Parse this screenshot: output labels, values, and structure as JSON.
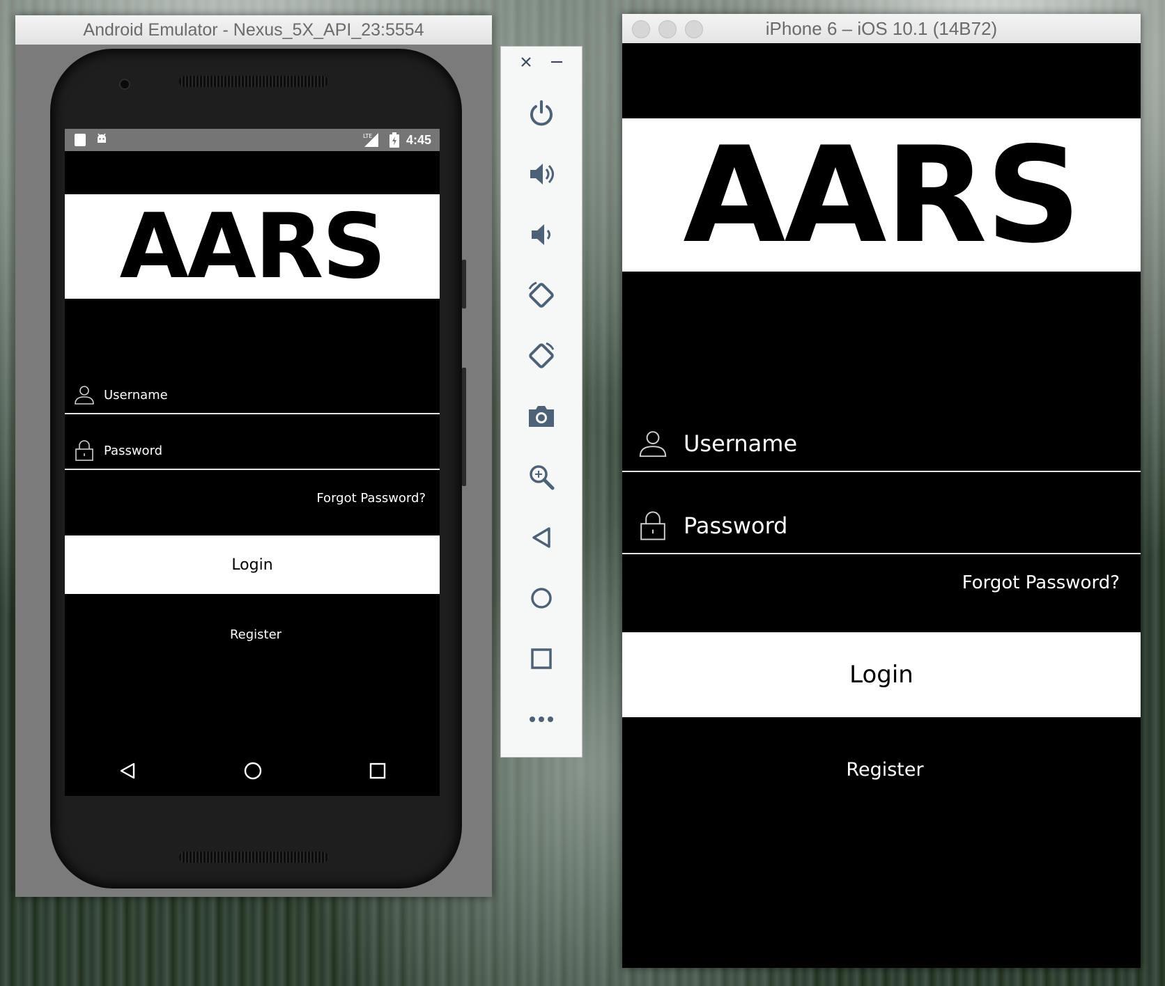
{
  "android": {
    "window_title": "Android Emulator - Nexus_5X_API_23:5554",
    "status_time": "4:45",
    "status_network": "LTE",
    "app": {
      "logo": "AARS",
      "username_label": "Username",
      "password_label": "Password",
      "forgot_password": "Forgot Password?",
      "login_button": "Login",
      "register_link": "Register"
    }
  },
  "toolbar": {
    "buttons": [
      "power-icon",
      "volume-up-icon",
      "volume-down-icon",
      "rotate-left-icon",
      "rotate-right-icon",
      "camera-icon",
      "zoom-icon",
      "back-icon",
      "home-icon",
      "overview-icon",
      "more-icon"
    ]
  },
  "ios": {
    "window_title": "iPhone 6 – iOS 10.1 (14B72)",
    "app": {
      "logo": "AARS",
      "username_label": "Username",
      "password_label": "Password",
      "forgot_password": "Forgot Password?",
      "login_button": "Login",
      "register_link": "Register"
    }
  },
  "colors": {
    "app_background": "#000000",
    "button_background": "#ffffff",
    "android_statusbar": "#757575",
    "window_frame": "#7b7b7b"
  }
}
